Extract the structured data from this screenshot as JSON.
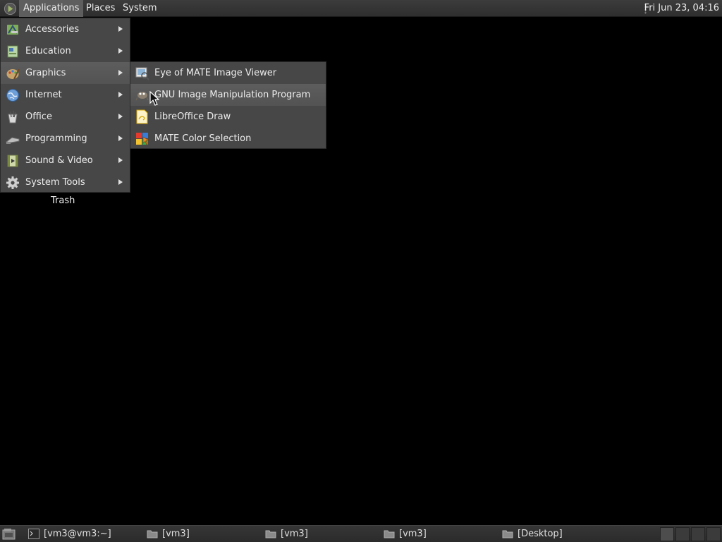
{
  "top_panel": {
    "menus": [
      {
        "label": "Applications",
        "active": true
      },
      {
        "label": "Places"
      },
      {
        "label": "System"
      }
    ],
    "clock": "Fri Jun 23, 04:16",
    "logo_icon": "mate-logo-icon"
  },
  "app_menu": {
    "items": [
      {
        "label": "Accessories",
        "icon": "accessories-icon"
      },
      {
        "label": "Education",
        "icon": "education-icon"
      },
      {
        "label": "Graphics",
        "icon": "graphics-icon",
        "hover": true
      },
      {
        "label": "Internet",
        "icon": "internet-globe-icon"
      },
      {
        "label": "Office",
        "icon": "office-icon"
      },
      {
        "label": "Programming",
        "icon": "programming-icon"
      },
      {
        "label": "Sound & Video",
        "icon": "sound-video-icon"
      },
      {
        "label": "System Tools",
        "icon": "system-tools-gear-icon"
      }
    ]
  },
  "graphics_submenu": {
    "items": [
      {
        "label": "Eye of MATE Image Viewer",
        "icon": "image-viewer-icon"
      },
      {
        "label": "GNU Image Manipulation Program",
        "icon": "gimp-icon",
        "hover": true
      },
      {
        "label": "LibreOffice Draw",
        "icon": "libreoffice-draw-icon"
      },
      {
        "label": "MATE Color Selection",
        "icon": "color-selection-icon"
      }
    ]
  },
  "desktop": {
    "trash_label": "Trash"
  },
  "taskbar": {
    "tasks": [
      {
        "label": "[vm3@vm3:~]",
        "icon": "terminal-icon"
      },
      {
        "label": "[vm3]",
        "icon": "folder-icon"
      },
      {
        "label": "[vm3]",
        "icon": "folder-icon"
      },
      {
        "label": "[vm3]",
        "icon": "folder-icon"
      },
      {
        "label": "[Desktop]",
        "icon": "folder-icon"
      }
    ]
  },
  "colors": {
    "panel": "#333333",
    "menu_bg": "#474747",
    "menu_hover": "#585858",
    "desktop": "#000000"
  }
}
